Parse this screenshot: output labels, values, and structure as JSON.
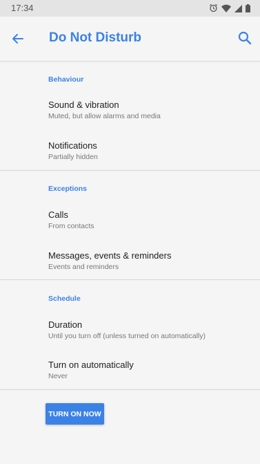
{
  "status_bar": {
    "time": "17:34",
    "icons": [
      "alarm-icon",
      "wifi-icon",
      "signal-icon",
      "battery-icon"
    ]
  },
  "app_bar": {
    "title": "Do Not Disturb",
    "back_icon": "arrow-back-icon",
    "search_icon": "search-icon"
  },
  "sections": {
    "behaviour": {
      "header": "Behaviour",
      "items": [
        {
          "title": "Sound & vibration",
          "summary": "Muted, but allow alarms and media"
        },
        {
          "title": "Notifications",
          "summary": "Partially hidden"
        }
      ]
    },
    "exceptions": {
      "header": "Exceptions",
      "items": [
        {
          "title": "Calls",
          "summary": "From contacts"
        },
        {
          "title": "Messages, events & reminders",
          "summary": "Events and reminders"
        }
      ]
    },
    "schedule": {
      "header": "Schedule",
      "items": [
        {
          "title": "Duration",
          "summary": "Until you turn off (unless turned on automatically)"
        },
        {
          "title": "Turn on automatically",
          "summary": "Never"
        }
      ]
    }
  },
  "action": {
    "turn_on_label": "TURN ON NOW"
  },
  "colors": {
    "accent": "#3b82e6",
    "background": "#f5f5f5",
    "status_bar": "#e4e4e4"
  }
}
